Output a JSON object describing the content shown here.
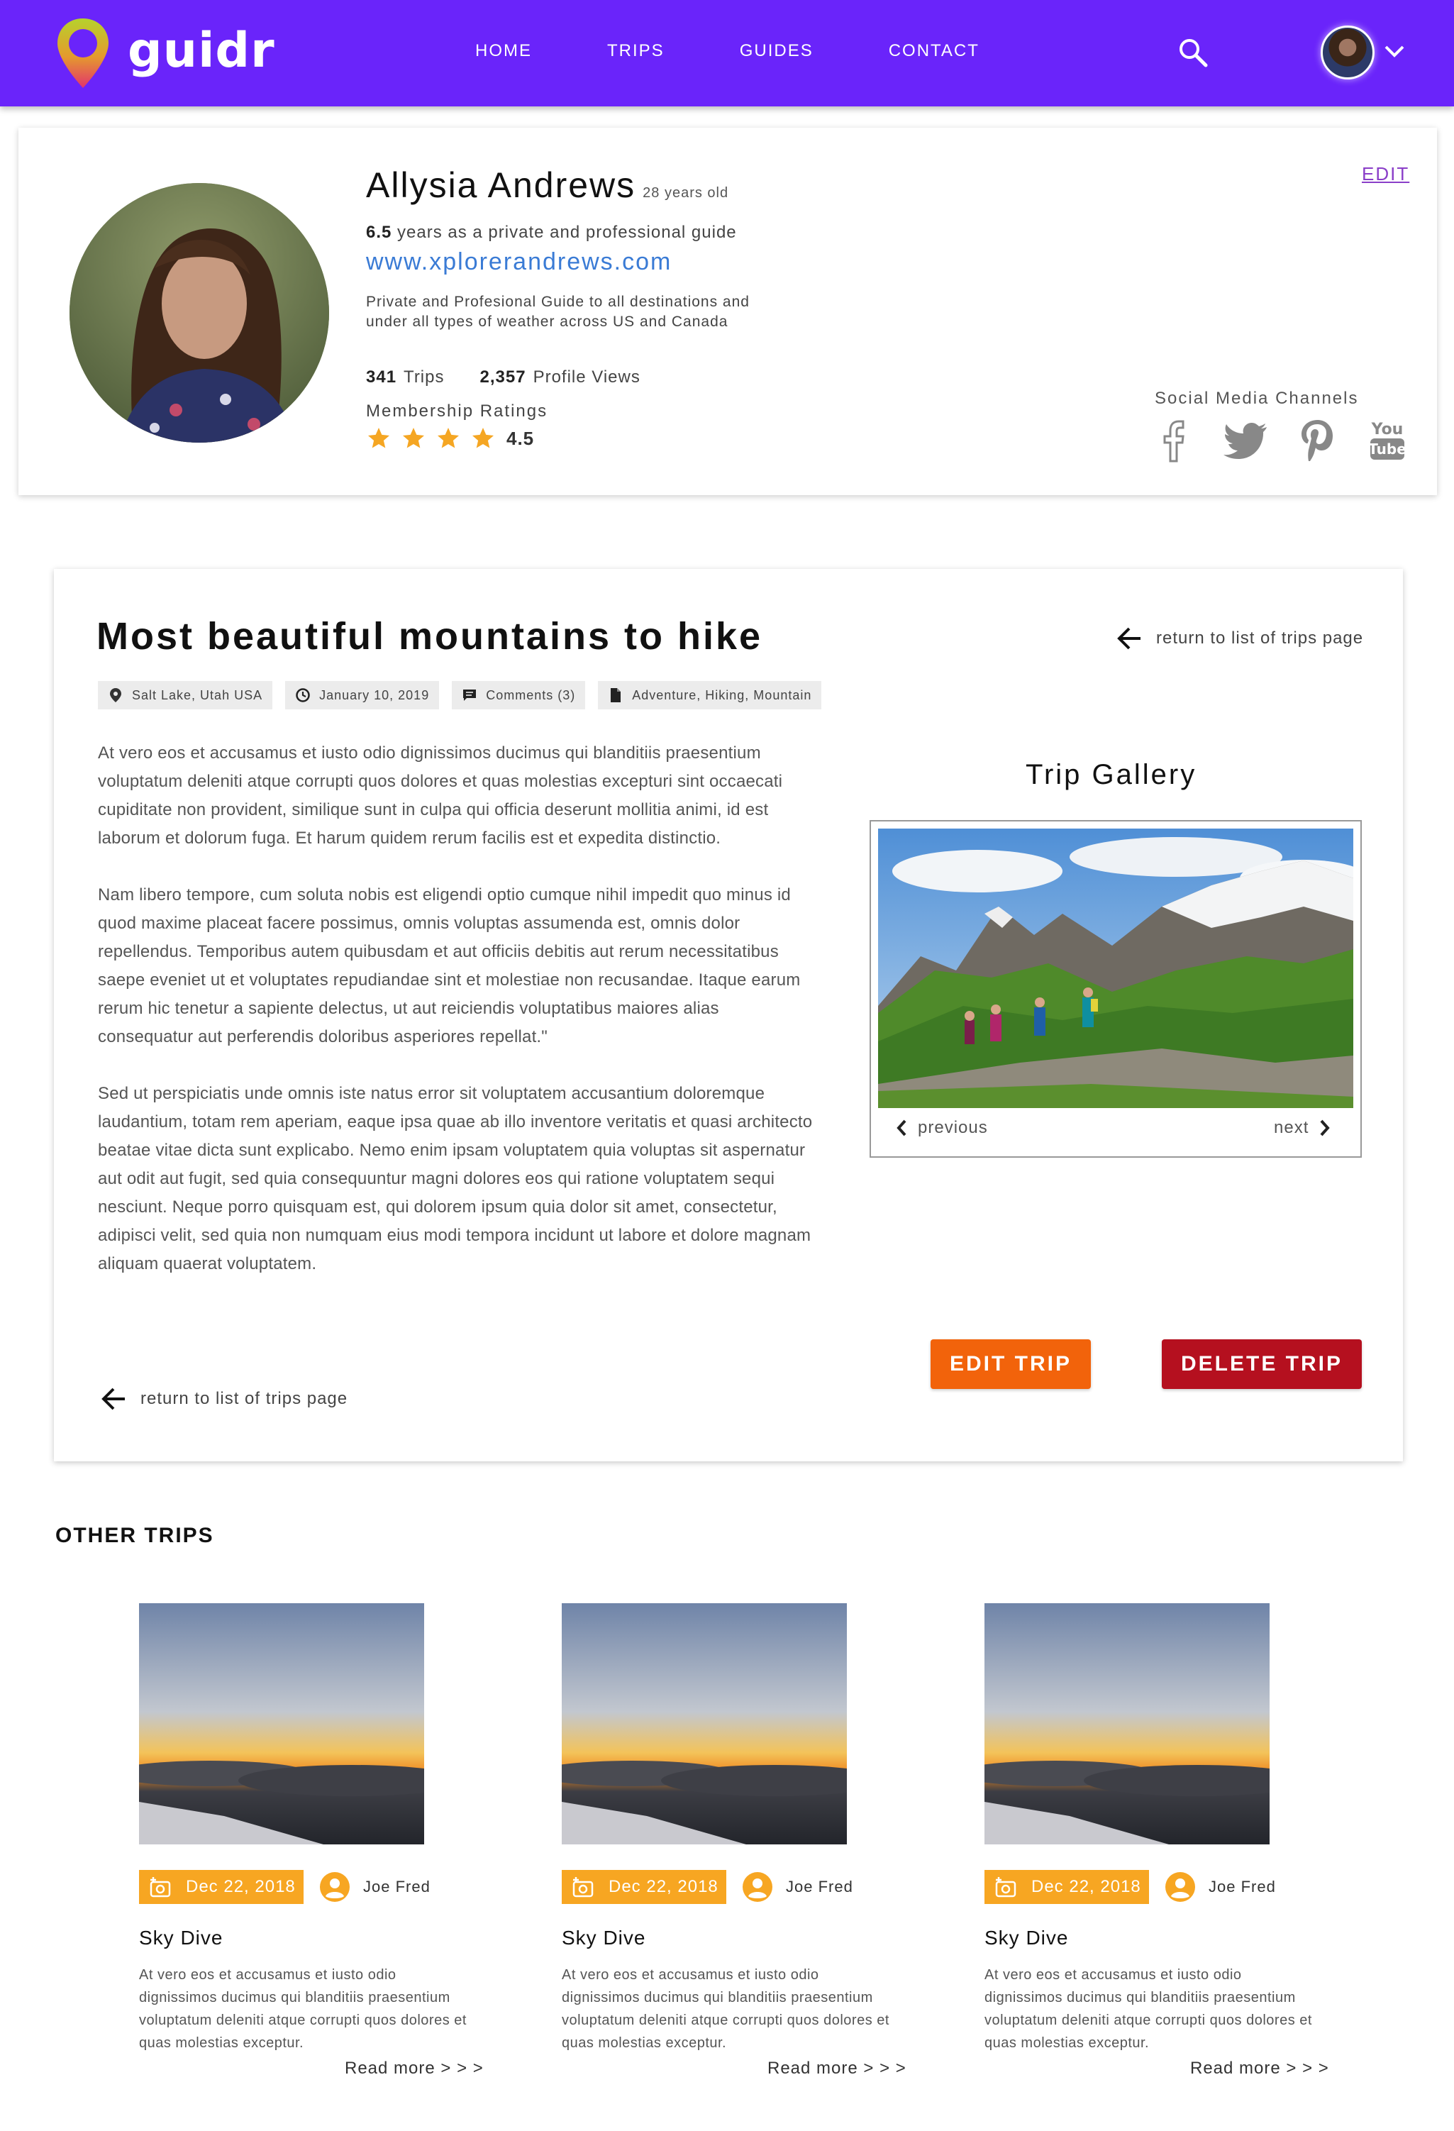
{
  "navbar": {
    "logo_text": "guidr",
    "links": [
      {
        "label": "HOME"
      },
      {
        "label": "TRIPS"
      },
      {
        "label": "GUIDES"
      },
      {
        "label": "CONTACT"
      }
    ],
    "brand_color": "#6a24fa"
  },
  "profile": {
    "name": "Allysia Andrews",
    "age": "28 years old",
    "experience_years": "6.5",
    "experience_text": "years as a private and professional guide",
    "website": "www.xplorerandrews.com",
    "description": "Private and Profesional Guide to all destinations and under all types of weather across US and Canada",
    "trips_count": "341",
    "trips_label": "Trips",
    "views_count": "2,357",
    "views_label": "Profile Views",
    "ratings_label": "Membership Ratings",
    "rating_value": "4.5",
    "rating_stars": 4,
    "edit_label": "EDIT",
    "social_label": "Social Media Channels",
    "social_icons": [
      "facebook-icon",
      "twitter-icon",
      "pinterest-icon",
      "youtube-icon"
    ]
  },
  "trip": {
    "title": "Most beautiful mountains to hike",
    "return_label": "return to list of trips page",
    "tags": [
      {
        "icon": "location-pin-icon",
        "label": "Salt Lake, Utah USA"
      },
      {
        "icon": "clock-icon",
        "label": "January 10, 2019"
      },
      {
        "icon": "comment-icon",
        "label": "Comments (3)"
      },
      {
        "icon": "document-icon",
        "label": "Adventure, Hiking, Mountain"
      }
    ],
    "paragraphs": [
      "At vero eos et accusamus et iusto odio dignissimos ducimus qui blanditiis praesentium voluptatum deleniti atque corrupti quos dolores et quas molestias excepturi sint occaecati cupiditate non provident, similique sunt in culpa qui officia deserunt mollitia animi, id est laborum et dolorum fuga. Et harum quidem rerum facilis est et expedita distinctio.",
      "Nam libero tempore, cum soluta nobis est eligendi optio cumque nihil impedit quo minus id quod maxime placeat facere possimus, omnis voluptas assumenda est, omnis dolor repellendus. Temporibus autem quibusdam et aut officiis debitis aut rerum necessitatibus saepe eveniet ut et voluptates repudiandae sint et molestiae non recusandae. Itaque earum rerum hic tenetur a sapiente delectus, ut aut reiciendis voluptatibus maiores alias consequatur aut perferendis doloribus asperiores repellat.\"",
      "Sed ut perspiciatis unde omnis iste natus error sit voluptatem accusantium doloremque laudantium, totam rem aperiam, eaque ipsa quae ab illo inventore veritatis et quasi architecto beatae vitae dicta sunt explicabo. Nemo enim ipsam voluptatem quia voluptas sit aspernatur aut odit aut fugit, sed quia consequuntur magni dolores eos qui ratione voluptatem sequi nesciunt. Neque porro quisquam est, qui dolorem ipsum quia dolor sit amet, consectetur, adipisci velit, sed quia non numquam eius modi tempora incidunt ut labore et dolore magnam aliquam quaerat voluptatem."
    ],
    "gallery_title": "Trip Gallery",
    "gallery_prev": "previous",
    "gallery_next": "next",
    "edit_button": "EDIT TRIP",
    "delete_button": "DELETE TRIP",
    "edit_color": "#f2630b",
    "delete_color": "#b5101f"
  },
  "other_trips": {
    "heading": "OTHER TRIPS",
    "items": [
      {
        "date": "Dec 22, 2018",
        "author": "Joe Fred",
        "title": "Sky Dive",
        "desc": "At vero eos et accusamus et iusto odio dignissimos ducimus qui blanditiis praesentium voluptatum deleniti atque corrupti quos dolores et quas molestias exceptur.",
        "read_more": "Read more > > >"
      },
      {
        "date": "Dec 22, 2018",
        "author": "Joe Fred",
        "title": "Sky Dive",
        "desc": "At vero eos et accusamus et iusto odio dignissimos ducimus qui blanditiis praesentium voluptatum deleniti atque corrupti quos dolores et quas molestias exceptur.",
        "read_more": "Read more > > >"
      },
      {
        "date": "Dec 22, 2018",
        "author": "Joe Fred",
        "title": "Sky Dive",
        "desc": "At vero eos et accusamus et iusto odio dignissimos ducimus qui blanditiis praesentium voluptatum deleniti atque corrupti quos dolores et quas molestias exceptur.",
        "read_more": "Read more > > >"
      }
    ],
    "badge_color": "#f7a622"
  }
}
